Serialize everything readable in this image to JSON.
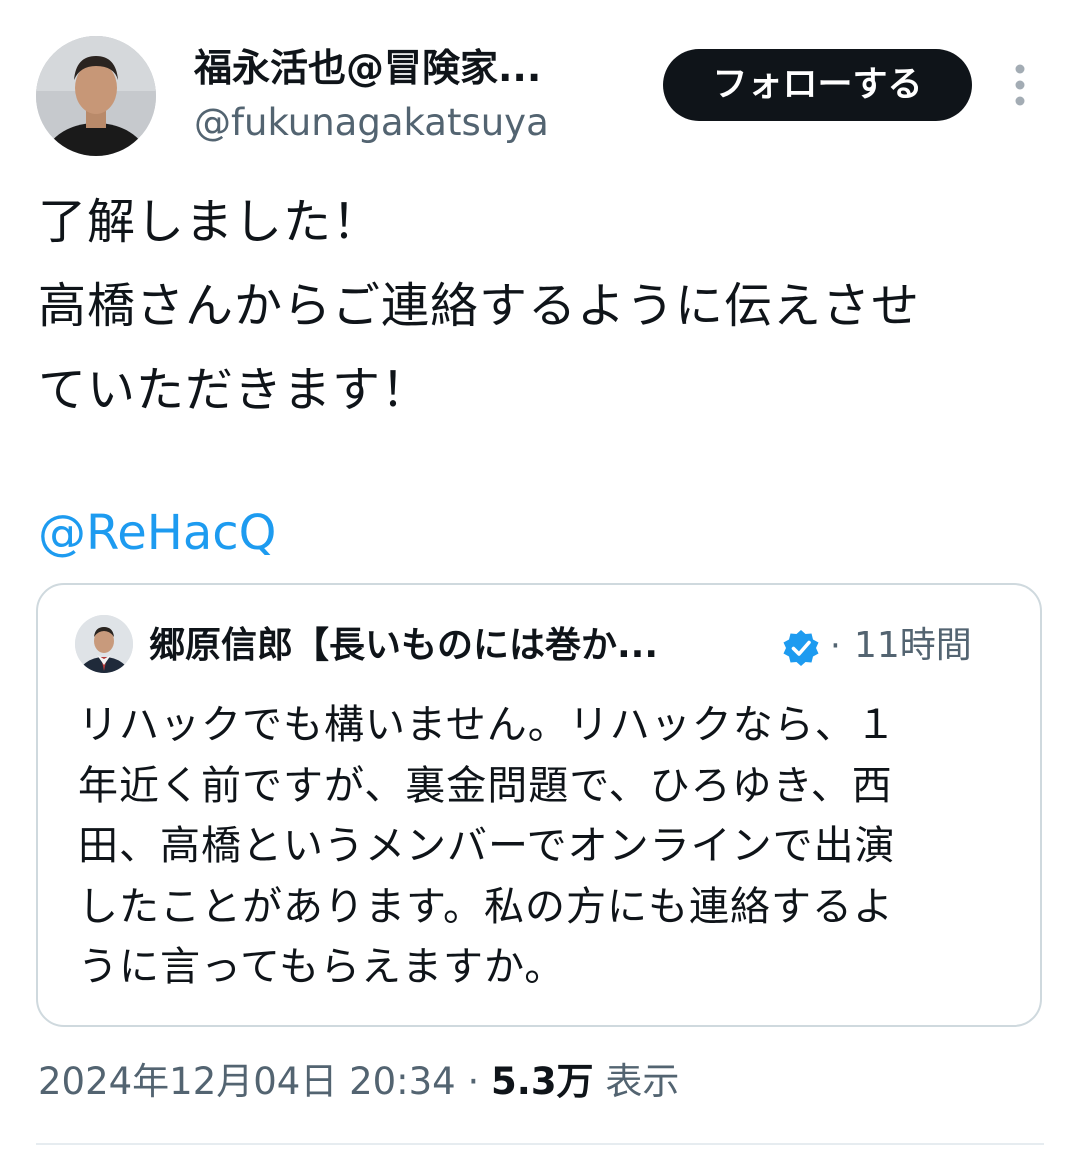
{
  "tweet": {
    "author": {
      "display_name": "福永活也@冒険家...",
      "handle": "@fukunagakatsuya"
    },
    "follow_label": "フォローする",
    "text_lines": [
      "了解しました！",
      "高橋さんからご連絡するように伝えさせ",
      "ていただきます！"
    ],
    "mention": "@ReHacQ",
    "quoted": {
      "display_name": "郷原信郎【長いものには巻か...",
      "separator": "·",
      "time": "11時間",
      "text_lines": [
        "リハックでも構いません。リハックなら、１",
        "年近く前ですが、裏金問題で、ひろゆき、西",
        "田、高橋というメンバーでオンラインで出演",
        "したことがあります。私の方にも連絡するよ",
        "うに言ってもらえますか。"
      ]
    },
    "meta": {
      "datetime": "2024年12月04日 20:34",
      "separator": "·",
      "views_count": "5.3万",
      "views_label": "表示"
    }
  },
  "colors": {
    "text": "#0f1419",
    "secondary": "#536471",
    "link": "#1d9bf0",
    "follow_bg": "#0f1419",
    "border": "#cfd9de"
  },
  "icons": {
    "more": "more-vertical-icon",
    "verified": "verified-badge-icon"
  }
}
